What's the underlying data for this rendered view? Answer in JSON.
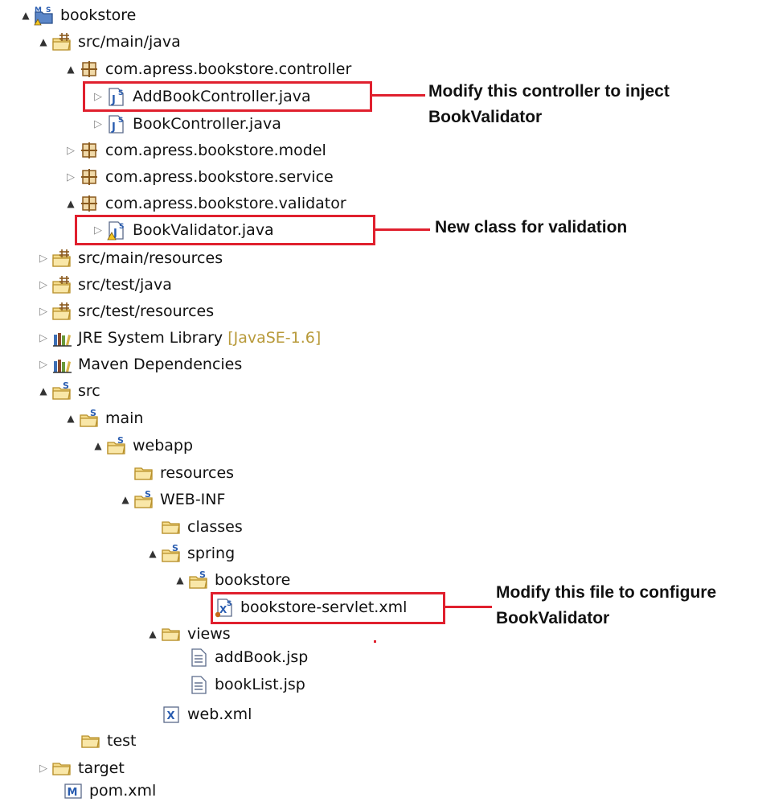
{
  "icons": {
    "expanded": "▲",
    "collapsed": "▷"
  },
  "tree": {
    "project": "bookstore",
    "src_main_java": "src/main/java",
    "pkg_controller": "com.apress.bookstore.controller",
    "add_book_controller": "AddBookController.java",
    "book_controller": "BookController.java",
    "pkg_model": "com.apress.bookstore.model",
    "pkg_service": "com.apress.bookstore.service",
    "pkg_validator": "com.apress.bookstore.validator",
    "book_validator": "BookValidator.java",
    "src_main_resources": "src/main/resources",
    "src_test_java": "src/test/java",
    "src_test_resources": "src/test/resources",
    "jre_library": "JRE System Library",
    "jre_version": "[JavaSE-1.6]",
    "maven_deps": "Maven Dependencies",
    "src": "src",
    "main": "main",
    "webapp": "webapp",
    "resources": "resources",
    "web_inf": "WEB-INF",
    "classes": "classes",
    "spring": "spring",
    "bookstore_folder": "bookstore",
    "bookstore_servlet": "bookstore-servlet.xml",
    "views": "views",
    "add_book_jsp": "addBook.jsp",
    "book_list_jsp": "bookList.jsp",
    "web_xml": "web.xml",
    "test": "test",
    "target": "target",
    "pom_xml": "pom.xml"
  },
  "annotations": {
    "controller_line1": "Modify this controller to inject",
    "controller_line2": "BookValidator",
    "validator_note": "New class for validation",
    "servlet_line1": "Modify this file to configure",
    "servlet_line2": "BookValidator"
  },
  "colors": {
    "callout": "#e0202e",
    "package_brown": "#8a5a1e",
    "folder_yellow": "#e8c060",
    "java_blue": "#2a5db0",
    "decoration": "#b89a3a"
  }
}
